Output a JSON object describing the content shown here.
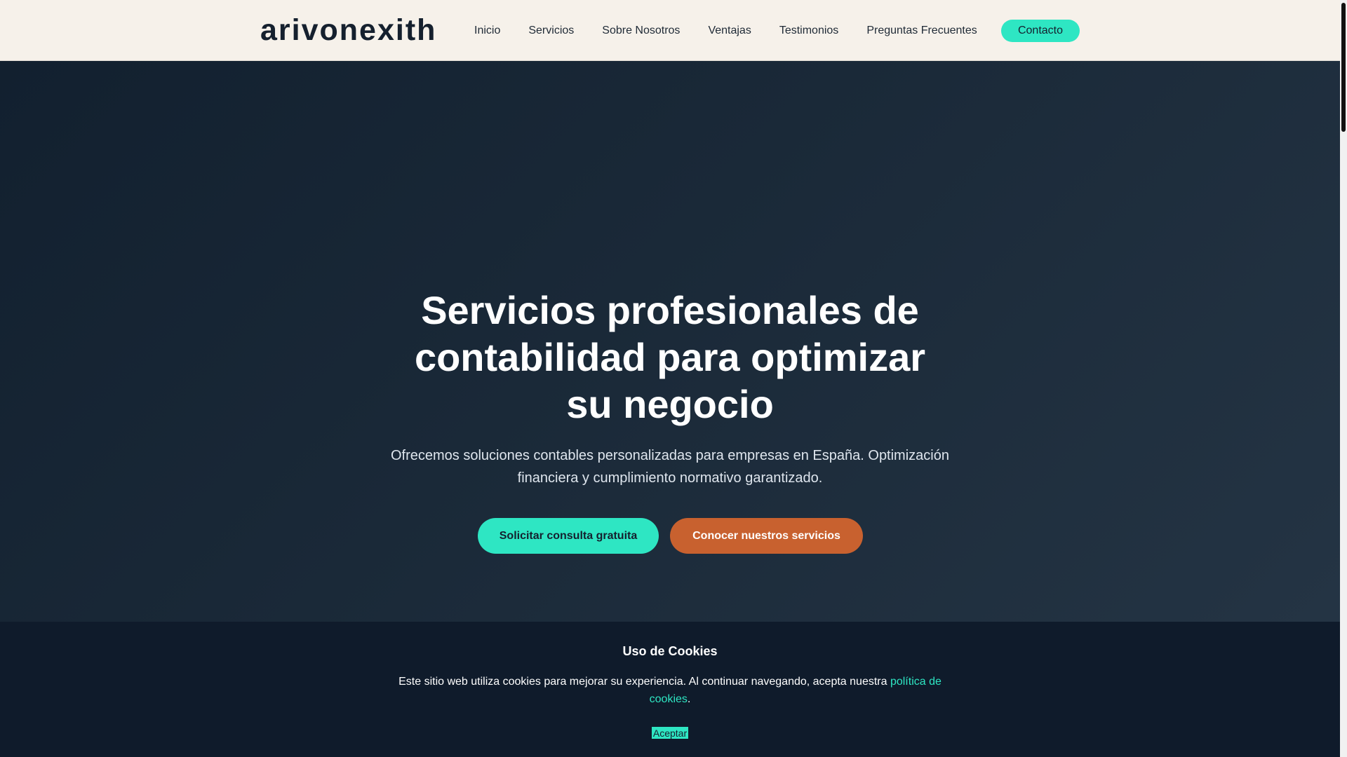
{
  "header": {
    "logo": "arivonexith",
    "nav": [
      {
        "label": "Inicio"
      },
      {
        "label": "Servicios"
      },
      {
        "label": "Sobre Nosotros"
      },
      {
        "label": "Ventajas"
      },
      {
        "label": "Testimonios"
      },
      {
        "label": "Preguntas Frecuentes"
      }
    ],
    "contact_label": "Contacto"
  },
  "hero": {
    "title": "Servicios profesionales de contabilidad para optimizar su negocio",
    "subtitle": "Ofrecemos soluciones contables personalizadas para empresas en España. Optimización financiera y cumplimiento normativo garantizado.",
    "primary_button": "Solicitar consulta gratuita",
    "secondary_button": "Conocer nuestros servicios"
  },
  "cookie_banner": {
    "title": "Uso de Cookies",
    "text": "Este sitio web utiliza cookies para mejorar su experiencia. Al continuar navegando, acepta nuestra ",
    "link_text": "política de cookies",
    "text_end": ".",
    "accept_label": "Aceptar"
  },
  "colors": {
    "accent": "#2ee6c3",
    "secondary": "#c8612f",
    "header_bg": "#f6f1ea",
    "hero_bg": "#1a2938",
    "banner_bg": "#0f1b2b"
  }
}
